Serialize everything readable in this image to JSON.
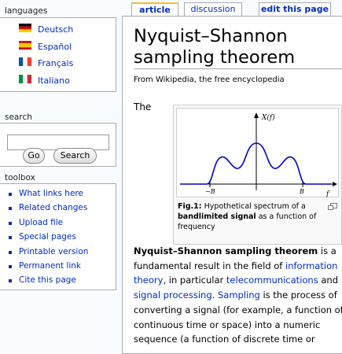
{
  "sidebar": {
    "languages": {
      "heading": "languages",
      "items": [
        {
          "label": "Deutsch",
          "flag": "flag-de-icon"
        },
        {
          "label": "Español",
          "flag": "flag-es-icon"
        },
        {
          "label": "Français",
          "flag": "flag-fr-icon"
        },
        {
          "label": "Italiano",
          "flag": "flag-it-icon"
        }
      ]
    },
    "search": {
      "heading": "search",
      "input_value": "",
      "go_label": "Go",
      "search_label": "Search"
    },
    "toolbox": {
      "heading": "toolbox",
      "items": [
        "What links here",
        "Related changes",
        "Upload file",
        "Special pages",
        "Printable version",
        "Permanent link",
        "Cite this page"
      ]
    }
  },
  "tabs": [
    {
      "label": "article",
      "selected": true
    },
    {
      "label": "discussion",
      "selected": false
    },
    {
      "label": "edit this page",
      "selected": false
    }
  ],
  "article": {
    "title": "Nyquist–Shannon sampling theorem",
    "subtitle": "From Wikipedia, the free encyclopedia",
    "lead_word": "The",
    "figure": {
      "axis_y_label": "X(f)",
      "axis_x_label": "f",
      "tick_neg": "−B",
      "tick_pos": "B",
      "caption_prefix": "Fig.1:",
      "caption_text_1": " Hypothetical spectrum of a ",
      "caption_link": "bandlimited signal",
      "caption_text_2": " as a function of frequency"
    },
    "paragraph": {
      "bold_term": "Nyquist–Shannon sampling theorem",
      "t1": " is a fundamental result in the field of ",
      "link1": "information theory",
      "t2": ", in particular ",
      "link2": "telecommunications",
      "t3": " and ",
      "link3": "signal processing",
      "t4": ". ",
      "link4": "Sampling",
      "t5": " is the process of converting a signal (for example, a function of continuous time or space) into a numeric sequence (a function of discrete time or"
    }
  },
  "colors": {
    "link": "#002bb8",
    "curve": "#0000cc",
    "tab_selected_accent": "#fabd23"
  }
}
